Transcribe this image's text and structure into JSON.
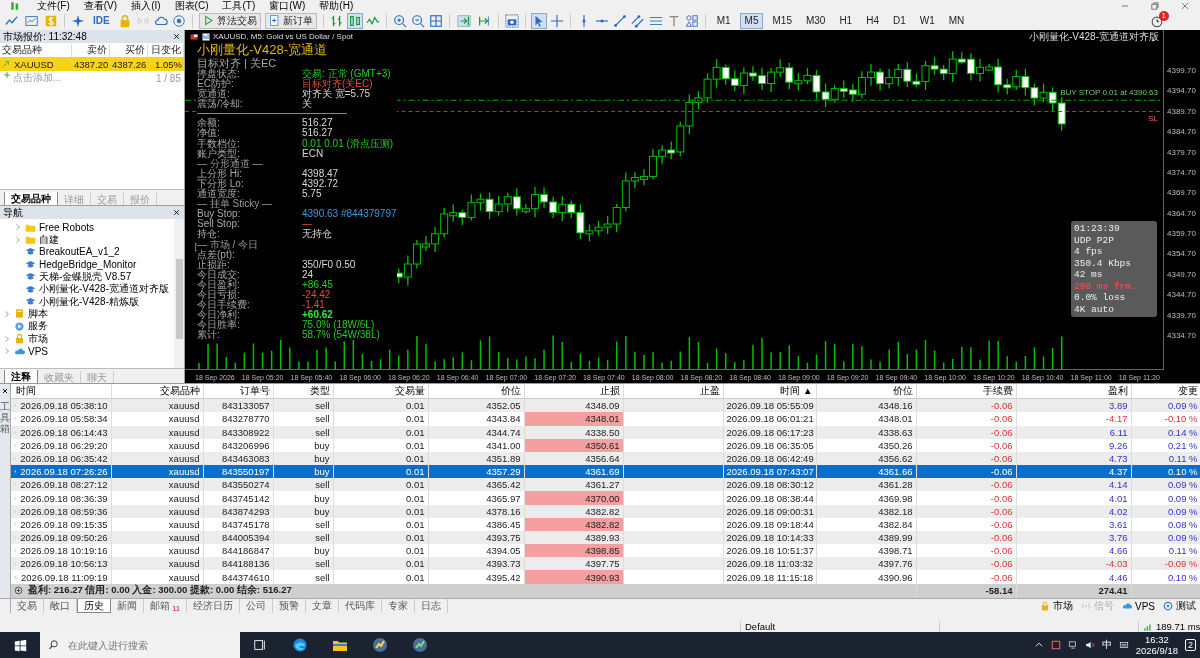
{
  "menu": {
    "items": [
      "文件(F)",
      "查看(V)",
      "插入(I)",
      "图表(C)",
      "工具(T)",
      "窗口(W)",
      "帮助(H)"
    ]
  },
  "toolbar": {
    "ide": "IDE",
    "algo_trading": "算法交易",
    "new_order": "新订单",
    "notifications": "1",
    "timeframes": [
      {
        "label": "M1",
        "selected": false
      },
      {
        "label": "M5",
        "selected": true
      },
      {
        "label": "M15",
        "selected": false
      },
      {
        "label": "M30",
        "selected": false
      },
      {
        "label": "H1",
        "selected": false
      },
      {
        "label": "H4",
        "selected": false
      },
      {
        "label": "D1",
        "selected": false
      },
      {
        "label": "W1",
        "selected": false
      },
      {
        "label": "MN",
        "selected": false
      }
    ]
  },
  "market_watch": {
    "title": "市场报价: 11:32:48",
    "columns": [
      "交易品种",
      "卖价",
      "买价",
      "日变化"
    ],
    "rows": [
      {
        "symbol": "XAUUSD",
        "bid": "4387.20",
        "ask": "4387.26",
        "change": "1.05%",
        "selected": true
      }
    ],
    "add_label": "点击添加...",
    "count": "1 / 85",
    "tabs": [
      {
        "label": "交易品种",
        "selected": true
      },
      {
        "label": "详细",
        "selected": false
      },
      {
        "label": "交易",
        "selected": false
      },
      {
        "label": "报价",
        "selected": false
      }
    ]
  },
  "navigator": {
    "title": "导航",
    "nested_items": [
      {
        "label": "Free Robots",
        "kind": "folder",
        "expanded": false
      },
      {
        "label": "自建",
        "kind": "folder",
        "expanded": false
      },
      {
        "label": "BreakoutEA_v1_2",
        "kind": "expert"
      },
      {
        "label": "HedgeBridge_Monitor",
        "kind": "expert"
      },
      {
        "label": "天梯-金蝶脱壳 V8.57",
        "kind": "expert"
      },
      {
        "label": "小刚量化-V428-宽通道对齐版",
        "kind": "expert"
      },
      {
        "label": "小刚量化-V428-精炼版",
        "kind": "expert"
      }
    ],
    "items": [
      {
        "label": "脚本",
        "kind": "script",
        "expanded": false
      },
      {
        "label": "服务",
        "kind": "service"
      },
      {
        "label": "市场",
        "kind": "market",
        "expanded": false
      },
      {
        "label": "VPS",
        "kind": "vps",
        "expanded": false
      }
    ],
    "tabs": [
      {
        "label": "注释",
        "selected": true
      },
      {
        "label": "收藏夹",
        "selected": false
      },
      {
        "label": "聊天",
        "selected": false
      }
    ]
  },
  "chart": {
    "title": "XAUUSD, M5:  Gold vs US Dollar / Spot",
    "indicator": "小刚量化-V428-宽通道对齐版",
    "order_line_label": "BUY STOP 0.01 at 4390.63",
    "sl_label": "SL",
    "panel": {
      "title": "小刚量化-V428-宽通道",
      "subtitle": "目标对齐 | 关EC",
      "rows": [
        {
          "kind": "positive",
          "label": "停盘状态:",
          "value": "交易: 正常 (GMT+3)"
        },
        {
          "kind": "negative",
          "label": "EC防护:",
          "value": "目标对齐(关EC)"
        },
        {
          "kind": "neutral",
          "label": "宽通道:",
          "value": "对齐关 宽=5.75"
        },
        {
          "kind": "neutral",
          "label": "震荡/冷却:",
          "value": "关"
        },
        {
          "kind": "divider"
        },
        {
          "kind": "neutral",
          "label": "余额:",
          "value": "516.27"
        },
        {
          "kind": "neutral",
          "label": "净值:",
          "value": "516.27"
        },
        {
          "kind": "positive",
          "label": "手数档位:",
          "value": "0.01  0.01 (滑点压测)"
        },
        {
          "kind": "neutral",
          "label": "账户类型:",
          "value": "ECN"
        },
        {
          "kind": "heading",
          "label": "— 分形通道 —"
        },
        {
          "kind": "neutral",
          "label": "上分形 Hi:",
          "value": "4398.47"
        },
        {
          "kind": "neutral",
          "label": "下分形 Lo:",
          "value": "4392.72"
        },
        {
          "kind": "neutral",
          "label": "通道宽度:",
          "value": "5.75"
        },
        {
          "kind": "heading",
          "label": "— 挂单 Sticky —"
        },
        {
          "kind": "info",
          "label": "Buy Stop:",
          "value": "4390.63 #844379797"
        },
        {
          "kind": "negative",
          "label": "Sell Stop:",
          "value": "—"
        },
        {
          "kind": "neutral",
          "label": "持仓:",
          "value": "无持仓"
        },
        {
          "kind": "heading",
          "label": "— 市场 / 今日"
        },
        {
          "kind": "label",
          "label": "点差(pt):"
        },
        {
          "kind": "neutral",
          "label": "止损距:",
          "value": "350/F0 0.50"
        },
        {
          "kind": "neutral",
          "label": "今日成交:",
          "value": "24"
        },
        {
          "kind": "positive",
          "label": "今日盈利:",
          "value": "+86.45"
        },
        {
          "kind": "negative",
          "label": "今日亏损:",
          "value": "-24.42"
        },
        {
          "kind": "negative",
          "label": "今日手续费:",
          "value": "-1.41"
        },
        {
          "kind": "total",
          "label": "今日净利:",
          "value": "+60.62"
        },
        {
          "kind": "positive",
          "label": "今日胜率:",
          "value": "75.0% (18W/6L)"
        },
        {
          "kind": "positive",
          "label": "累计:",
          "value": "58.7% (54W/38L)"
        }
      ]
    },
    "price_axis": [
      "4399.70",
      "4394.70",
      "4389.70",
      "4384.70",
      "4379.70",
      "4374.70",
      "4369.70",
      "4364.70",
      "4359.70",
      "4354.70",
      "4349.70",
      "4344.70",
      "4339.70",
      "4334.70"
    ],
    "time_axis": [
      "18 Sep 2026",
      "18 Sep 05:20",
      "18 Sep 05:40",
      "18 Sep 06:00",
      "18 Sep 06:20",
      "18 Sep 06:40",
      "18 Sep 07:00",
      "18 Sep 07:20",
      "18 Sep 07:40",
      "18 Sep 08:00",
      "18 Sep 08:20",
      "18 Sep 08:40",
      "18 Sep 09:00",
      "18 Sep 09:20",
      "18 Sep 09:40",
      "18 Sep 10:00",
      "18 Sep 10:20",
      "18 Sep 10:40",
      "18 Sep 11:00",
      "18 Sep 11:20"
    ]
  },
  "history": {
    "columns": [
      "时间",
      "交易品种",
      "订单号",
      "类型",
      "交易量",
      "价位",
      "止损",
      "止盈",
      "时间 ▲",
      "价位",
      "手续费",
      "盈利",
      "变更"
    ],
    "rows": [
      {
        "open_time": "2026.09.18 05:38:10",
        "symbol": "xauusd",
        "order": "843133057",
        "type": "sell",
        "kind": "sell",
        "volume": "0.01",
        "open_price": "4352.05",
        "sl": "4348.09",
        "tp": "",
        "close_time": "2026.09.18 05:55:09",
        "close_price": "4348.16",
        "fee": "-0.06",
        "profit": "3.89",
        "change": "0.09 %",
        "loss": false,
        "selected": false
      },
      {
        "open_time": "2026.09.18 05:58:34",
        "symbol": "xauusd",
        "order": "843278770",
        "type": "sell",
        "kind": "sell",
        "volume": "0.01",
        "open_price": "4343.84",
        "sl": "4348.01",
        "tp": "",
        "close_time": "2026.09.18 06:01:21",
        "close_price": "4348.01",
        "fee": "-0.06",
        "profit": "-4.17",
        "change": "-0.10 %",
        "loss": true,
        "selected": false
      },
      {
        "open_time": "2026.09.18 06:14:43",
        "symbol": "xauusd",
        "order": "843308922",
        "type": "sell",
        "kind": "sell",
        "volume": "0.01",
        "open_price": "4344.74",
        "sl": "4338.50",
        "tp": "",
        "close_time": "2026.09.18 06:17:23",
        "close_price": "4338.63",
        "fee": "-0.06",
        "profit": "6.11",
        "change": "0.14 %",
        "loss": false,
        "selected": false
      },
      {
        "open_time": "2026.09.18 06:29:20",
        "symbol": "xauusd",
        "order": "843206996",
        "type": "buy",
        "kind": "buy",
        "volume": "0.01",
        "open_price": "4341.00",
        "sl": "4350.61",
        "tp": "",
        "close_time": "2026.09.18 06:35:05",
        "close_price": "4350.26",
        "fee": "-0.06",
        "profit": "9.26",
        "change": "0.21 %",
        "loss": false,
        "selected": false
      },
      {
        "open_time": "2026.09.18 06:35:42",
        "symbol": "xauusd",
        "order": "843463083",
        "type": "buy",
        "kind": "buy",
        "volume": "0.01",
        "open_price": "4351.89",
        "sl": "4356.64",
        "tp": "",
        "close_time": "2026.09.18 06:42:49",
        "close_price": "4356.62",
        "fee": "-0.06",
        "profit": "4.73",
        "change": "0.11 %",
        "loss": false,
        "selected": false
      },
      {
        "open_time": "2026.09.18 07:26:26",
        "symbol": "xauusd",
        "order": "843550197",
        "type": "buy",
        "kind": "buy",
        "volume": "0.01",
        "open_price": "4357.29",
        "sl": "4361.69",
        "tp": "",
        "close_time": "2026.09.18 07:43:07",
        "close_price": "4361.66",
        "fee": "-0.06",
        "profit": "4.37",
        "change": "0.10 %",
        "loss": false,
        "selected": true
      },
      {
        "open_time": "2026.09.18 08:27:12",
        "symbol": "xauusd",
        "order": "843550274",
        "type": "sell",
        "kind": "sell",
        "volume": "0.01",
        "open_price": "4365.42",
        "sl": "4361.27",
        "tp": "",
        "close_time": "2026.09.18 08:30:12",
        "close_price": "4361.28",
        "fee": "-0.06",
        "profit": "4.14",
        "change": "0.09 %",
        "loss": false,
        "selected": false
      },
      {
        "open_time": "2026.09.18 08:36:39",
        "symbol": "xauusd",
        "order": "843745142",
        "type": "buy",
        "kind": "buy",
        "volume": "0.01",
        "open_price": "4365.97",
        "sl": "4370.00",
        "tp": "",
        "close_time": "2026.09.18 08:38:44",
        "close_price": "4369.98",
        "fee": "-0.06",
        "profit": "4.01",
        "change": "0.09 %",
        "loss": false,
        "selected": false
      },
      {
        "open_time": "2026.09.18 08:59:36",
        "symbol": "xauusd",
        "order": "843874293",
        "type": "buy",
        "kind": "buy",
        "volume": "0.01",
        "open_price": "4378.16",
        "sl": "4382.82",
        "tp": "",
        "close_time": "2026.09.18 09:00:31",
        "close_price": "4382.18",
        "fee": "-0.06",
        "profit": "4.02",
        "change": "0.09 %",
        "loss": false,
        "selected": false
      },
      {
        "open_time": "2026.09.18 09:15:35",
        "symbol": "xauusd",
        "order": "843745178",
        "type": "sell",
        "kind": "sell",
        "volume": "0.01",
        "open_price": "4386.45",
        "sl": "4382.82",
        "tp": "",
        "close_time": "2026.09.18 09:18:44",
        "close_price": "4382.84",
        "fee": "-0.06",
        "profit": "3.61",
        "change": "0.08 %",
        "loss": false,
        "selected": false
      },
      {
        "open_time": "2026.09.18 09:50:26",
        "symbol": "xauusd",
        "order": "844005394",
        "type": "sell",
        "kind": "sell",
        "volume": "0.01",
        "open_price": "4393.75",
        "sl": "4389.93",
        "tp": "",
        "close_time": "2026.09.18 10:14:33",
        "close_price": "4389.99",
        "fee": "-0.06",
        "profit": "3.76",
        "change": "0.09 %",
        "loss": false,
        "selected": false
      },
      {
        "open_time": "2026.09.18 10:19:16",
        "symbol": "xauusd",
        "order": "844186847",
        "type": "buy",
        "kind": "buy",
        "volume": "0.01",
        "open_price": "4394.05",
        "sl": "4398.85",
        "tp": "",
        "close_time": "2026.09.18 10:51:37",
        "close_price": "4398.71",
        "fee": "-0.06",
        "profit": "4.66",
        "change": "0.11 %",
        "loss": false,
        "selected": false
      },
      {
        "open_time": "2026.09.18 10:56:13",
        "symbol": "xauusd",
        "order": "844188136",
        "type": "sell",
        "kind": "sell",
        "volume": "0.01",
        "open_price": "4393.73",
        "sl": "4397.75",
        "tp": "",
        "close_time": "2026.09.18 11:03:32",
        "close_price": "4397.76",
        "fee": "-0.06",
        "profit": "-4.03",
        "change": "-0.09 %",
        "loss": true,
        "selected": false
      },
      {
        "open_time": "2026.09.18 11:09:19",
        "symbol": "xauusd",
        "order": "844374610",
        "type": "sell",
        "kind": "sell",
        "volume": "0.01",
        "open_price": "4395.42",
        "sl": "4390.93",
        "tp": "",
        "close_time": "2026.09.18 11:15:18",
        "close_price": "4390.96",
        "fee": "-0.06",
        "profit": "4.46",
        "change": "0.10 %",
        "loss": false,
        "selected": false
      }
    ],
    "summary": "盈利: 216.27  信用: 0.00  入金: 300.00  提款: 0.00  结余: 516.27",
    "fee_total": "-58.14",
    "profit_total": "274.41",
    "toolbox_label": "工具箱"
  },
  "stream_overlay": {
    "lines": [
      {
        "text": "01:23:39",
        "warning": false
      },
      {
        "text": "UDP P2P",
        "warning": false
      },
      {
        "text": "4 fps",
        "warning": false
      },
      {
        "text": "350.4 Kbps",
        "warning": false
      },
      {
        "text": "42 ms",
        "warning": false
      },
      {
        "text": "298 ms frm.",
        "warning": true
      },
      {
        "text": "0.0% loss",
        "warning": false
      },
      {
        "text": "4K auto",
        "warning": false
      }
    ]
  },
  "bottom_tabs": {
    "tabs": [
      {
        "label": "交易",
        "selected": false
      },
      {
        "label": "敞口",
        "selected": false
      },
      {
        "label": "历史",
        "selected": true
      },
      {
        "label": "新闻",
        "selected": false
      },
      {
        "label": "邮箱",
        "selected": false,
        "badge": "11"
      },
      {
        "label": "经济日历",
        "selected": false
      },
      {
        "label": "公司",
        "selected": false
      },
      {
        "label": "预警",
        "selected": false
      },
      {
        "label": "文章",
        "selected": false
      },
      {
        "label": "代码库",
        "selected": false
      },
      {
        "label": "专家",
        "selected": false
      },
      {
        "label": "日志",
        "selected": false
      }
    ],
    "right": [
      {
        "label": "市场",
        "kind": "market",
        "disabled": false
      },
      {
        "label": "信号",
        "kind": "signal",
        "disabled": true
      },
      {
        "label": "VPS",
        "kind": "vps",
        "disabled": false
      },
      {
        "label": "测试",
        "kind": "tester",
        "disabled": false
      }
    ]
  },
  "status_bar": {
    "profile": "Default",
    "ping": "189.71 ms"
  },
  "taskbar": {
    "search_placeholder": "在此键入进行搜索",
    "ime": "中",
    "time": "16:32",
    "date": "2026/9/18",
    "notifications": "2"
  }
}
